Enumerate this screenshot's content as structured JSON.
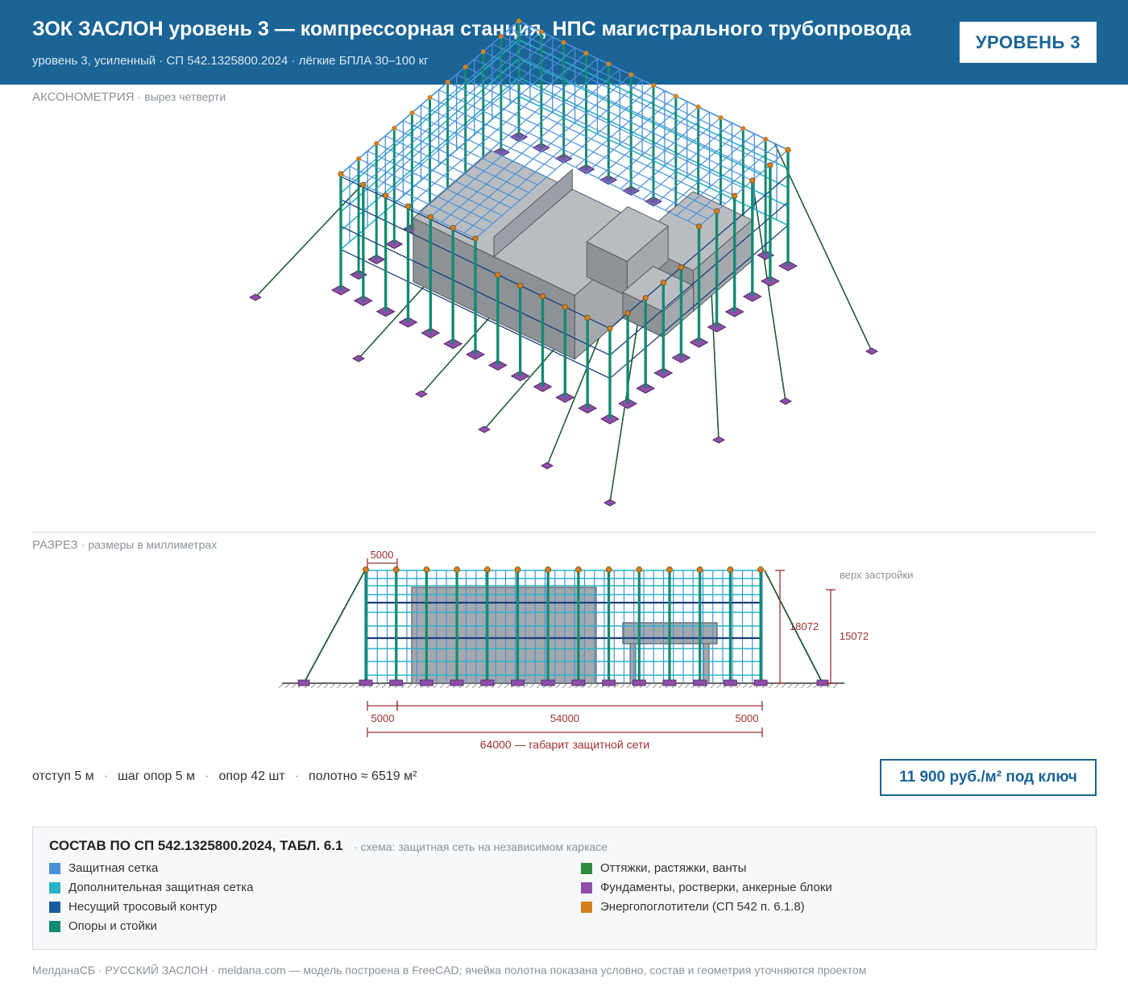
{
  "header": {
    "title": "ЗОК ЗАСЛОН уровень 3 — компрессорная станция, НПС магистрального трубопровода",
    "subtitle": "уровень 3, усиленный · СП 542.1325800.2024 · лёгкие БПЛА 30–100 кг",
    "badge": "УРОВЕНЬ 3"
  },
  "axonometry": {
    "label": "АКСОНОМЕТРИЯ",
    "note": "· вырез четверти"
  },
  "section": {
    "label": "РАЗРЕЗ",
    "note": "· размеры в миллиметрах",
    "dim_top_step": "5000",
    "dim_height_total": "18072",
    "dim_height_building": "15072",
    "top_label": "верх застройки",
    "dim_left": "5000",
    "dim_middle": "54000",
    "dim_right": "5000",
    "dim_overall": "64000 — габарит защитной сети"
  },
  "stats": {
    "offset": "отступ 5 м",
    "step": "шаг опор 5 м",
    "supports": "опор 42 шт",
    "area": "полотно ≈ 6519 м²",
    "separator": "·"
  },
  "price": "11 900 руб./м² под ключ",
  "legend": {
    "title": "СОСТАВ ПО СП 542.1325800.2024, ТАБЛ. 6.1",
    "note": "· схема: защитная сеть на независимом каркасе",
    "items": [
      {
        "label": "Защитная сетка",
        "color": "#4a90d9"
      },
      {
        "label": "Дополнительная защитная сетка",
        "color": "#29b3c9"
      },
      {
        "label": "Несущий тросовый контур",
        "color": "#1a5c9e"
      },
      {
        "label": "Опоры и стойки",
        "color": "#138a72"
      },
      {
        "label": "Оттяжки, растяжки, ванты",
        "color": "#2e8b3e"
      },
      {
        "label": "Фундаменты, ростверки, анкерные блоки",
        "color": "#8e4fa8"
      },
      {
        "label": "Энергопоглотители (СП 542 п. 6.1.8)",
        "color": "#d4801c"
      }
    ]
  },
  "footer": "МелданаСБ · РУССКИЙ ЗАСЛОН · meldana.com — модель построена в FreeCAD; ячейка полотна показана условно, состав и геометрия уточняются проектом"
}
